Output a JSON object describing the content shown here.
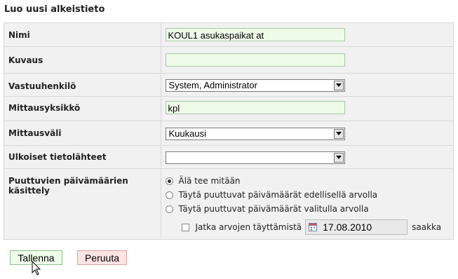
{
  "page": {
    "title": "Luo uusi alkeistieto"
  },
  "fields": {
    "nimi": {
      "label": "Nimi",
      "value": "KOUL1 asukaspaikat at"
    },
    "kuvaus": {
      "label": "Kuvaus",
      "value": ""
    },
    "vastuuhenkilo": {
      "label": "Vastuuhenkilö",
      "value": "System, Administrator"
    },
    "mittausyksikko": {
      "label": "Mittausyksikkö",
      "value": "kpl"
    },
    "mittausvali": {
      "label": "Mittausväli",
      "value": "Kuukausi"
    },
    "ulkoiset": {
      "label": "Ulkoiset tietolähteet",
      "value": ""
    },
    "puuttuvat": {
      "label": "Puuttuvien päivämäärien käsittely",
      "options": [
        "Älä tee mitään",
        "Täytä puuttuvat päivämäärät edellisellä arvolla",
        "Täytä puuttuvat päivämäärät valitulla arvolla"
      ],
      "selected_index": 0,
      "continue_label": "Jatka arvojen täyttämistä",
      "continue_checked": false,
      "date": "17.08.2010",
      "until_label": "saakka"
    }
  },
  "buttons": {
    "save": "Tallenna",
    "cancel": "Peruuta"
  },
  "icons": {
    "dropdown": "chevron-down-icon",
    "calendar": "calendar-icon",
    "cursor": "mouse-pointer-icon"
  }
}
